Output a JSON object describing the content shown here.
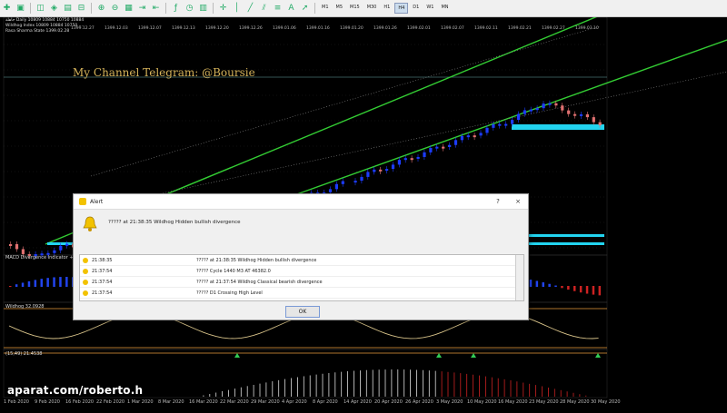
{
  "toolbar": {
    "timeframes": [
      "M1",
      "M5",
      "M15",
      "M30",
      "H1",
      "H4",
      "D1",
      "W1",
      "MN"
    ],
    "active_timeframe": "H4"
  },
  "chart": {
    "header_lines": [
      "جاهلة  Daily  10809 10884 10750 10884",
      "Wildhog Index 10809 10884 10750 ...",
      "Rasa Sharma State  1399.02.28"
    ],
    "time_labels": [
      "1399.12.27",
      "1399.12.03",
      "1399.12.07",
      "1399.12.13",
      "1399.12.20",
      "1399.12.26",
      "1399.01.06",
      "1399.01.16",
      "1399.01.20",
      "1399.01.26",
      "1399.02.01",
      "1399.02.07",
      "1399.02.11",
      "1399.02.21",
      "1399.02.27",
      "1399.03.10"
    ],
    "promo_text": "My Channel Telegram: @Boursie",
    "macd_label": "MACD Divergence Indicator +0.97",
    "wildhog_label": "Wildhog 32.0928",
    "bars_label": "(15,49) 21.4538",
    "bottom_axis": [
      "1 Feb 2020",
      "9 Feb 2020",
      "16 Feb 2020",
      "22 Feb 2020",
      "1 Mar 2020",
      "8 Mar 2020",
      "16 Mar 2020",
      "22 Mar 2020",
      "29 Mar 2020",
      "4 Apr 2020",
      "8 Apr 2020",
      "14 Apr 2020",
      "20 Apr 2020",
      "26 Apr 2020",
      "3 May 2020",
      "10 May 2020",
      "16 May 2020",
      "23 May 2020",
      "28 May 2020",
      "30 May 2020"
    ],
    "watermark": "aparat.com/roberto.h",
    "colors": {
      "bull": "#1c3cff",
      "bear": "#e07070",
      "channel": "#33cc33",
      "level": "#22d4f0",
      "macd_red": "#cc2222"
    }
  },
  "alert": {
    "title": "Alert",
    "help": "?",
    "close": "×",
    "message": "????? at 21:38:35 Wildhog Hidden bullish divergence",
    "rows": [
      {
        "time": "21:38:35",
        "msg": "????? at 21:38:35 Wildhog Hidden bullish divergence"
      },
      {
        "time": "21:37:54",
        "msg": "????? Cycle 1440 M3 AT 46382.0"
      },
      {
        "time": "21:37:54",
        "msg": "????? at 21:37:54 Wildhog Classical bearish divergence"
      },
      {
        "time": "21:37:54",
        "msg": "????? D1 Crossing High Level"
      }
    ],
    "ok_label": "OK"
  }
}
